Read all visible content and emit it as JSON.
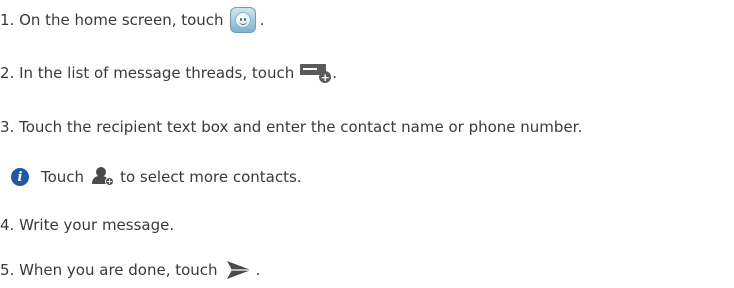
{
  "steps": [
    {
      "text": "1. On the home screen, touch",
      "after": ".",
      "icon": "messaging-app-icon"
    },
    {
      "text": "2. In the list of message threads, touch",
      "after": ".",
      "icon": "new-message-icon"
    },
    {
      "text": "3. Touch the recipient text box and enter the contact name or phone number.",
      "after": "",
      "icon": ""
    },
    {
      "text": "4. Write your message.",
      "after": "",
      "icon": ""
    },
    {
      "text": "5. When you are done, touch",
      "after": ".",
      "icon": "send-icon"
    }
  ],
  "tip": {
    "before": "Touch",
    "after": "to select more contacts.",
    "icon": "add-contact-icon",
    "info_icon": "info-icon",
    "info_glyph": "i"
  },
  "colors": {
    "text": "#3a3a3a",
    "info_badge": "#1f58a8",
    "icon_dark": "#5a5a5a"
  }
}
